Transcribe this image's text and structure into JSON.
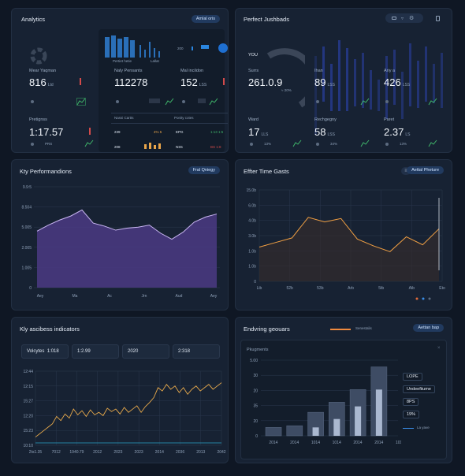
{
  "analytics": {
    "title": "Analytics",
    "pill": "Amlal oris",
    "left_metrics": [
      {
        "label": "Mear Yaqman",
        "value": "816",
        "unit": "Ltd"
      },
      {
        "label": "Pretignss",
        "value": "1:17.57",
        "unit": ""
      }
    ],
    "left_small": "PRS",
    "mid_chart_labels": [
      "Pertiet hetie",
      "Lallat"
    ],
    "mid_metrics": [
      {
        "label": "Naly Pensants",
        "value": "112278",
        "unit": ""
      },
      {
        "label": "Mal incildon",
        "value": "152",
        "unit": "LSS"
      }
    ],
    "mid_table": {
      "headers": [
        "Nassi Cartts",
        "Ponity cotes"
      ],
      "rows": [
        [
          "239",
          "4% 5",
          "EPG",
          "1:13 1:5"
        ],
        [
          "208",
          "",
          "NS5",
          "BS 1:8"
        ]
      ]
    },
    "mid_right_label": "200"
  },
  "perfect": {
    "title": "Perfect Jushbads",
    "metrics_top": [
      {
        "label": "Surrs",
        "value": "261.0.9",
        "unit": ""
      },
      {
        "label": "Ihan",
        "value": "89",
        "unit": "LSS"
      },
      {
        "label": "Ariy a",
        "value": "426",
        "unit": "LSS"
      }
    ],
    "donut_label": "YOU",
    "donut_center": "≈ 20%",
    "metrics_bottom": [
      {
        "label": "Ward",
        "value": "17",
        "unit": "LLS",
        "small": "13%"
      },
      {
        "label": "Rechgegny",
        "value": "58",
        "unit": "LSS",
        "small": "34%"
      },
      {
        "label": "Paret",
        "value": "2.37",
        "unit": "LS",
        "small": "13%"
      }
    ]
  },
  "kpi": {
    "title": "Kty Performandions",
    "pill": "Fral Qniegy",
    "chart_data": {
      "type": "area",
      "categories": [
        "Aey",
        "Ma",
        "Ac",
        "Jrn",
        "Aud",
        "Aey"
      ],
      "values": [
        56,
        62,
        67,
        71,
        77,
        64,
        61,
        57,
        59,
        60,
        62,
        54,
        48,
        55,
        65,
        70,
        73
      ],
      "y_ticks": [
        "0",
        "1.005",
        "2.005",
        "5.005",
        "8.504",
        "9.9:5"
      ],
      "color": "#8a6bd1"
    }
  },
  "effter": {
    "title": "Effter Time Gasts",
    "pill": "Aettal Pheture",
    "chart_data": {
      "type": "line",
      "categories": [
        "Lib",
        "52b",
        "53b",
        "Arb",
        "5tb",
        "Atb",
        "Eto"
      ],
      "values": [
        70,
        74,
        78,
        96,
        92,
        95,
        77,
        71,
        66,
        79,
        72,
        86
      ],
      "y_ticks": [
        "0",
        "1.0b",
        "1.0b",
        "3.0b",
        "4.0b",
        "6.0b",
        "15.0b"
      ],
      "color": "#f2a043"
    }
  },
  "key_indicators": {
    "title": "Kly ascibess indicators",
    "cards": [
      {
        "label": "Volcytes",
        "value": "1:018"
      },
      {
        "label": "",
        "value": "1:2.99"
      },
      {
        "label": "",
        "value": "2020"
      },
      {
        "label": "",
        "value": "2:318"
      }
    ],
    "chart_data": {
      "type": "line",
      "categories": [
        "2ts1.35",
        "7012",
        "1940.79",
        "2012",
        "2023",
        "2023",
        "2014",
        "2036",
        "2013",
        "2042"
      ],
      "values": [
        10,
        14,
        18,
        22,
        26,
        35,
        30,
        38,
        33,
        44,
        37,
        42,
        35,
        43,
        37,
        40,
        36,
        45,
        41,
        44,
        38,
        46,
        40,
        44,
        48,
        40,
        47,
        52,
        58,
        70,
        66,
        74,
        68,
        72,
        64,
        70,
        62,
        68,
        72,
        66,
        70,
        74,
        68,
        72,
        76
      ],
      "y_ticks": [
        "10:10",
        "15:23",
        "12:20",
        "15:27",
        "12:15",
        "12:44"
      ],
      "color": "#e7a94b"
    }
  },
  "enduring": {
    "title": "Endvring geouars",
    "legend": "Senestalis",
    "pill": "Aettan bap",
    "subtitle": "Pkugments",
    "chart_data": {
      "type": "bar",
      "categories": [
        "2014",
        "2014",
        "1014",
        "1014",
        "2014",
        "2014",
        "1014"
      ],
      "values": [
        10,
        12,
        28,
        40,
        55,
        82
      ],
      "inner": [
        0,
        0,
        10,
        20,
        35,
        55
      ],
      "y_ticks": [
        "0",
        "20",
        "35",
        "20",
        "30",
        "5.00"
      ],
      "color": "#7f90aa"
    },
    "legend_items": [
      "LOPE",
      "Undeefiiume",
      "8PS",
      "19%"
    ],
    "legend_small": "La yave"
  }
}
